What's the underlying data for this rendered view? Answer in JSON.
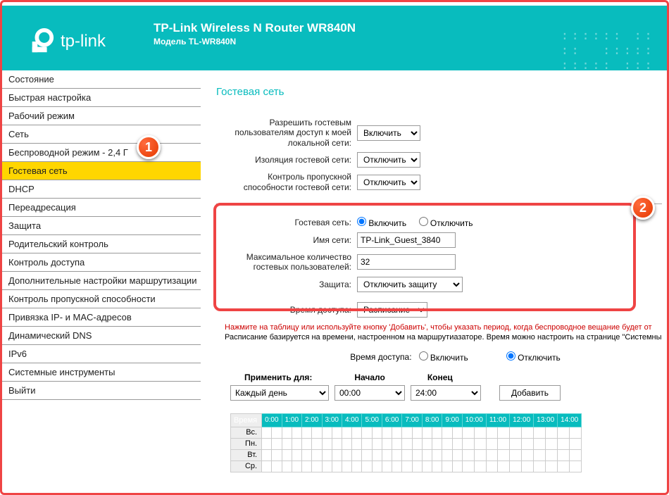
{
  "header": {
    "brand": "tp-link",
    "title": "TP-Link Wireless N Router WR840N",
    "model": "Модель TL-WR840N"
  },
  "nav": [
    "Состояние",
    "Быстрая настройка",
    "Рабочий режим",
    "Сеть",
    "Беспроводной режим - 2,4 Г",
    "Гостевая сеть",
    "DHCP",
    "Переадресация",
    "Защита",
    "Родительский контроль",
    "Контроль доступа",
    "Дополнительные настройки маршрутизации",
    "Контроль пропускной способности",
    "Привязка IP- и MAC-адресов",
    "Динамический DNS",
    "IPv6",
    "Системные инструменты",
    "Выйти"
  ],
  "nav_active_index": 5,
  "page": {
    "title": "Гостевая сеть",
    "rows": {
      "allow_local_label": "Разрешить гостевым пользователям доступ к моей локальной сети:",
      "allow_local_value": "Включить",
      "isolation_label": "Изоляция гостевой сети:",
      "isolation_value": "Отключить",
      "bandwidth_label": "Контроль пропускной способности гостевой сети:",
      "bandwidth_value": "Отключить",
      "guest_network_label": "Гостевая сеть:",
      "guest_on": "Включить",
      "guest_off": "Отключить",
      "ssid_label": "Имя сети:",
      "ssid_value": "TP-Link_Guest_3840",
      "max_users_label": "Максимальное количество гостевых пользователей:",
      "max_users_value": "32",
      "security_label": "Защита:",
      "security_value": "Отключить защиту",
      "access_time_label": "Время доступа:",
      "access_time_value": "Расписание"
    },
    "hints": {
      "red": "Нажмите на таблицу или используйте кнопку 'Добавить', чтобы указать период, когда беспроводное вещание будет от",
      "black": "Расписание базируется на времени, настроенном на маршрутиазаторе. Время можно настроить на странице \"Системные и"
    },
    "access_radio": {
      "label": "Время доступа:",
      "on": "Включить",
      "off": "Отключить"
    },
    "schedule": {
      "apply_label": "Применить для:",
      "start_label": "Начало",
      "end_label": "Конец",
      "apply_value": "Каждый день",
      "start_value": "00:00",
      "end_value": "24:00",
      "add_btn": "Добавить",
      "time_header": "Время",
      "hours": [
        "0:00",
        "1:00",
        "2:00",
        "3:00",
        "4:00",
        "5:00",
        "6:00",
        "7:00",
        "8:00",
        "9:00",
        "10:00",
        "11:00",
        "12:00",
        "13:00",
        "14:00"
      ],
      "days": [
        "Вс.",
        "Пн.",
        "Вт.",
        "Ср."
      ]
    }
  },
  "markers": {
    "one": "1",
    "two": "2"
  }
}
